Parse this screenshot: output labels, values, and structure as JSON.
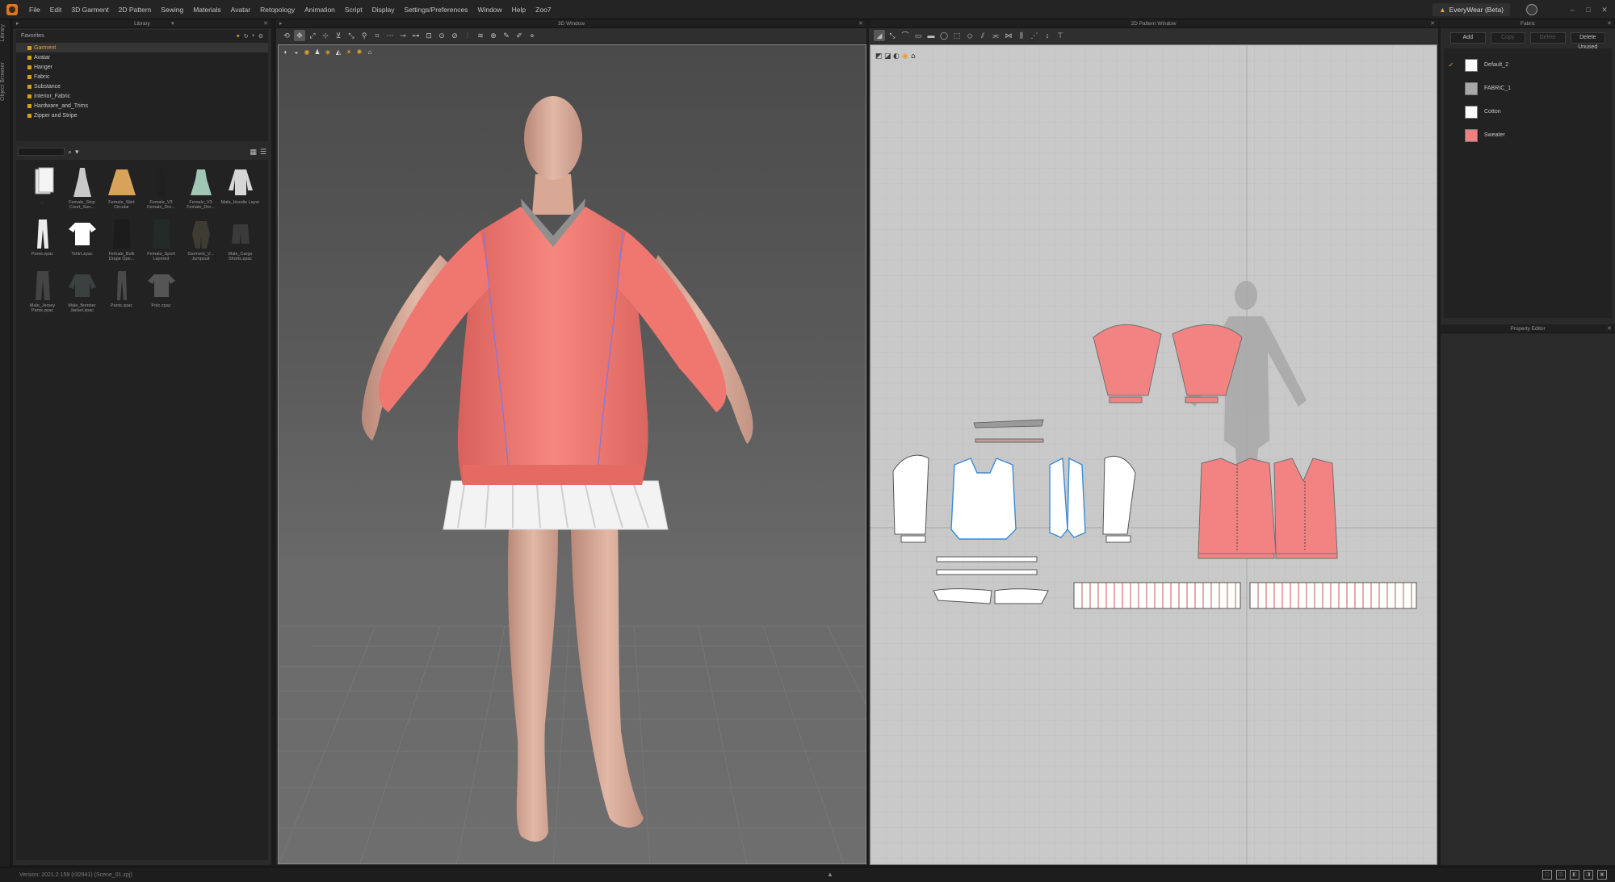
{
  "menu": {
    "items": [
      "File",
      "Edit",
      "3D Garment",
      "2D Pattern",
      "Sewing",
      "Materials",
      "Avatar",
      "Retopology",
      "Animation",
      "Script",
      "Display",
      "Settings/Preferences",
      "Window",
      "Help",
      "Zoo7"
    ],
    "edition": "EveryWear (Beta)"
  },
  "side_tabs": [
    "Library",
    "Object Browser"
  ],
  "library": {
    "header": "Library",
    "tree_title": "Favorites",
    "tree": [
      "Garment",
      "Avatar",
      "Hanger",
      "Fabric",
      "Substance",
      "Interior_Fabric",
      "Hardware_and_Trims",
      "Zipper and Stripe"
    ],
    "grid": [
      {
        "label": "..",
        "icon": "folder-icon"
      },
      {
        "label": "Female_Stop Court_Sun...",
        "icon": "dress-icon"
      },
      {
        "label": "Female_Skirt Circular",
        "icon": "skirt-icon"
      },
      {
        "label": "Female_V3 Female_Dre...",
        "icon": "gown-icon"
      },
      {
        "label": "Female_V3 Female_Dre...",
        "icon": "mint-dress-icon"
      },
      {
        "label": "Male_Hoodie Layer",
        "icon": "hoodie-icon"
      },
      {
        "label": "Pants.zpac",
        "icon": "pants-icon"
      },
      {
        "label": "Tshirt.zpac",
        "icon": "tshirt-icon"
      },
      {
        "label": "Female_Bulk Drape Ope...",
        "icon": "black-coat-icon"
      },
      {
        "label": "Female_Sport Layered",
        "icon": "black-jacket-icon"
      },
      {
        "label": "Garment_V... Jumpsuit",
        "icon": "jumpsuit-icon"
      },
      {
        "label": "Male_Cargo Shorts.zpac",
        "icon": "shorts-icon"
      },
      {
        "label": "Male_Jersey Pants.zpac",
        "icon": "jersey-pants-icon"
      },
      {
        "label": "Male_Bomber Jacket.zpac",
        "icon": "bomber-icon"
      },
      {
        "label": "Pants.zpac",
        "icon": "slim-pants-icon"
      },
      {
        "label": "Polo.zpac",
        "icon": "polo-icon"
      }
    ]
  },
  "window_3d": {
    "header": "3D Window"
  },
  "window_2d": {
    "header": "2D Pattern Window"
  },
  "fabric_panel": {
    "header": "Fabric",
    "buttons": [
      "Add",
      "Copy",
      "Delete",
      "Delete Unused"
    ],
    "fabrics": [
      {
        "name": "Default_2",
        "color": "#ffffff",
        "checked": true
      },
      {
        "name": "FABRIC_1",
        "color": "#a8a8a8",
        "checked": false
      },
      {
        "name": "Cotton",
        "color": "#ffffff",
        "checked": false
      },
      {
        "name": "Sweater",
        "color": "#f08080",
        "checked": false
      }
    ]
  },
  "property_panel": {
    "header": "Property Editor"
  },
  "status": {
    "text": "Version: 2021.2.159 (r32941) (Scene_01.zpj)"
  },
  "colors": {
    "accent": "#e3a43b",
    "garment": "#f07a72",
    "pattern_red": "#f38383"
  }
}
